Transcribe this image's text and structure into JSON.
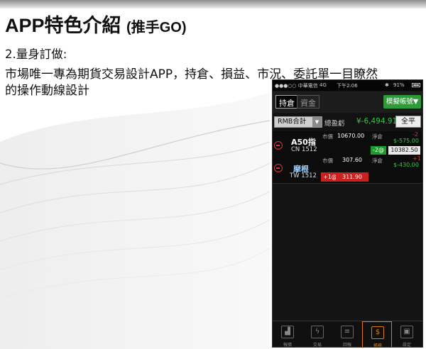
{
  "slide": {
    "title": "APP特色介紹",
    "title_sub": "(推手GO)",
    "point": "2.量身訂做:",
    "desc_line1": "市場唯一專為期貨交易設計APP，持倉、損益、市況、委託單一目瞭然",
    "desc_line2": "的操作動線設計"
  },
  "phone": {
    "status": {
      "carrier": "●●●○○ 中華電信",
      "network": "4G",
      "time": "下午2:06",
      "battery": "91%"
    },
    "tabs": [
      {
        "label": "持倉",
        "active": true
      },
      {
        "label": "資金",
        "active": false
      }
    ],
    "mode_button": "模擬帳號▼",
    "summary": {
      "currency_select": "RMB合計",
      "total_label": "總盈虧",
      "total_value": "¥-6,494.91",
      "close_all": "全平"
    },
    "positions": [
      {
        "name": "A50指",
        "code": "CN 1512",
        "market_label": "市價",
        "market_price": "10670.00",
        "net_label": "淨倉",
        "net_qty": "-2",
        "pl": "$-575.00",
        "order_qty": "-2@",
        "order_price": "10382.50"
      },
      {
        "name": "摩根",
        "code": "TW 1512",
        "market_label": "市價",
        "market_price": "307.60",
        "net_label": "淨倉",
        "net_qty": "+1",
        "pl": "$-430.00",
        "order_qty": "+1@",
        "order_price": "311.90"
      }
    ],
    "bottom_nav": [
      {
        "label": "報價",
        "icon": "chart-icon",
        "active": false
      },
      {
        "label": "交易",
        "icon": "bolt-icon",
        "active": false
      },
      {
        "label": "回報",
        "icon": "report-icon",
        "active": false
      },
      {
        "label": "帳務",
        "icon": "dollar-icon",
        "active": true
      },
      {
        "label": "設定",
        "icon": "settings-icon",
        "active": false
      }
    ]
  }
}
